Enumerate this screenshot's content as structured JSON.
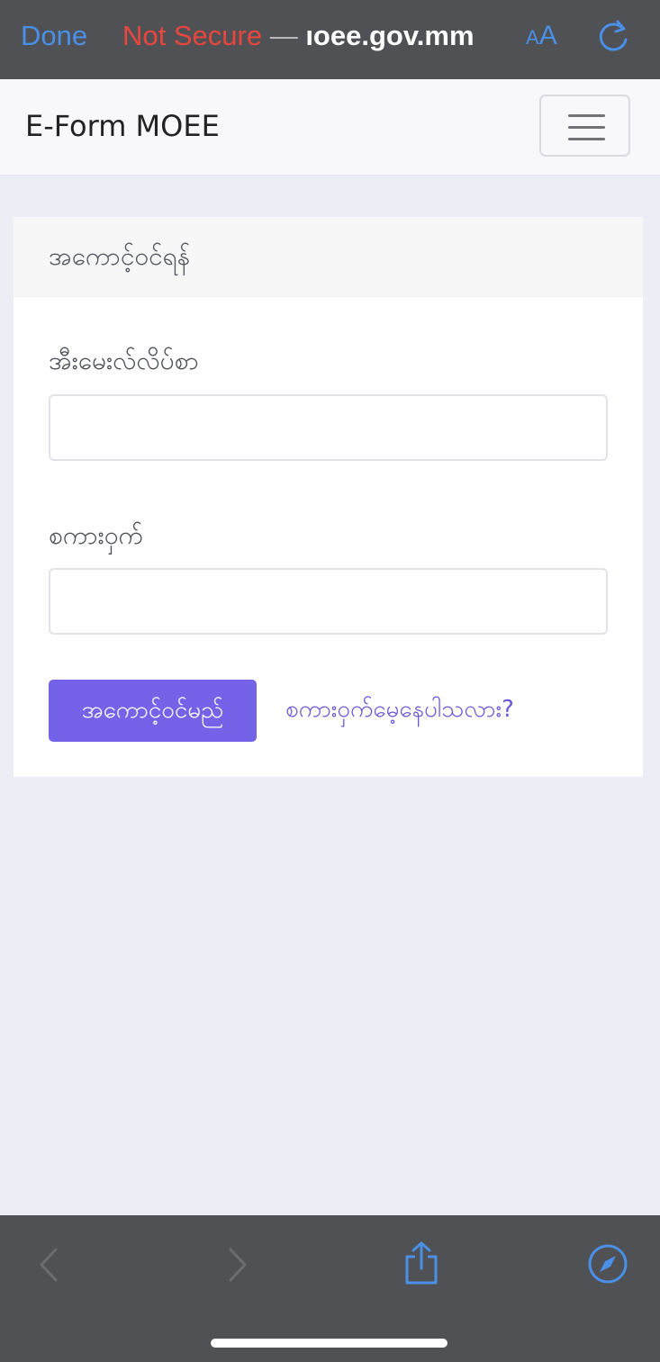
{
  "browser": {
    "done_label": "Done",
    "security_label": "Not Secure",
    "url_separator": " — ",
    "url_host": "ıoee.gov.mm",
    "text_size_small": "A",
    "text_size_large": "A",
    "icons": [
      "reload-icon",
      "back-icon",
      "forward-icon",
      "share-icon",
      "compass-icon"
    ]
  },
  "navbar": {
    "brand": "E-Form MOEE",
    "toggler_icon": "hamburger-icon"
  },
  "login_card": {
    "title": "အကောင့်ဝင်ရန်",
    "email_label": "အီးမေးလ်လိပ်စာ",
    "email_value": "",
    "password_label": "စကားဝှက်",
    "password_value": "",
    "login_button": "အကောင့်ဝင်မည်",
    "forgot_link": "စကားဝှက်မေ့နေပါသလား?"
  },
  "colors": {
    "accent": "#7462e9",
    "link": "#6b58d8",
    "browser_chrome": "#505154",
    "browser_blue": "#4a8fe8",
    "not_secure_red": "#e8463f",
    "page_background": "#ebeef4"
  }
}
